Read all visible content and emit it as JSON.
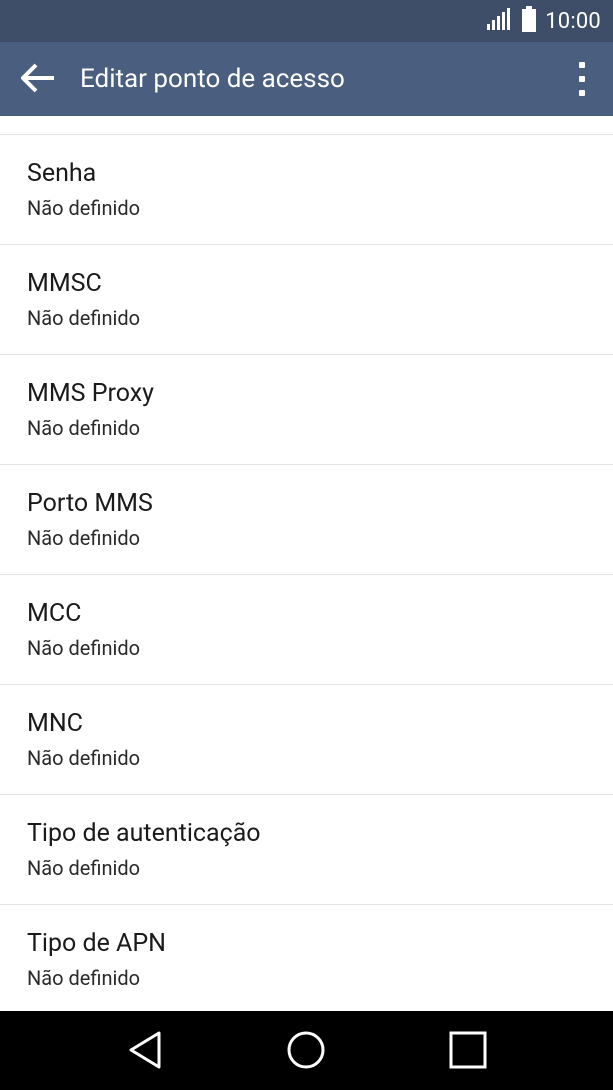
{
  "status_bar": {
    "time": "10:00",
    "signal_icon": "signal-icon",
    "battery_icon": "battery-icon"
  },
  "app_bar": {
    "title": "Editar ponto de acesso",
    "back_icon": "arrow-back-icon",
    "menu_icon": "overflow-menu-icon"
  },
  "settings": [
    {
      "title": "Senha",
      "summary": "Não definido"
    },
    {
      "title": "MMSC",
      "summary": "Não definido"
    },
    {
      "title": "MMS Proxy",
      "summary": "Não definido"
    },
    {
      "title": "Porto MMS",
      "summary": "Não definido"
    },
    {
      "title": "MCC",
      "summary": "Não definido"
    },
    {
      "title": "MNC",
      "summary": "Não definido"
    },
    {
      "title": "Tipo de autenticação",
      "summary": "Não definido"
    },
    {
      "title": "Tipo de APN",
      "summary": "Não definido"
    }
  ],
  "nav_bar": {
    "back_icon": "nav-back-icon",
    "home_icon": "nav-home-icon",
    "recents_icon": "nav-recents-icon"
  },
  "colors": {
    "status_bar": "#3e4d68",
    "app_bar": "#4a5e7f",
    "divider": "#e4e4e4",
    "nav_bar": "#000000"
  }
}
